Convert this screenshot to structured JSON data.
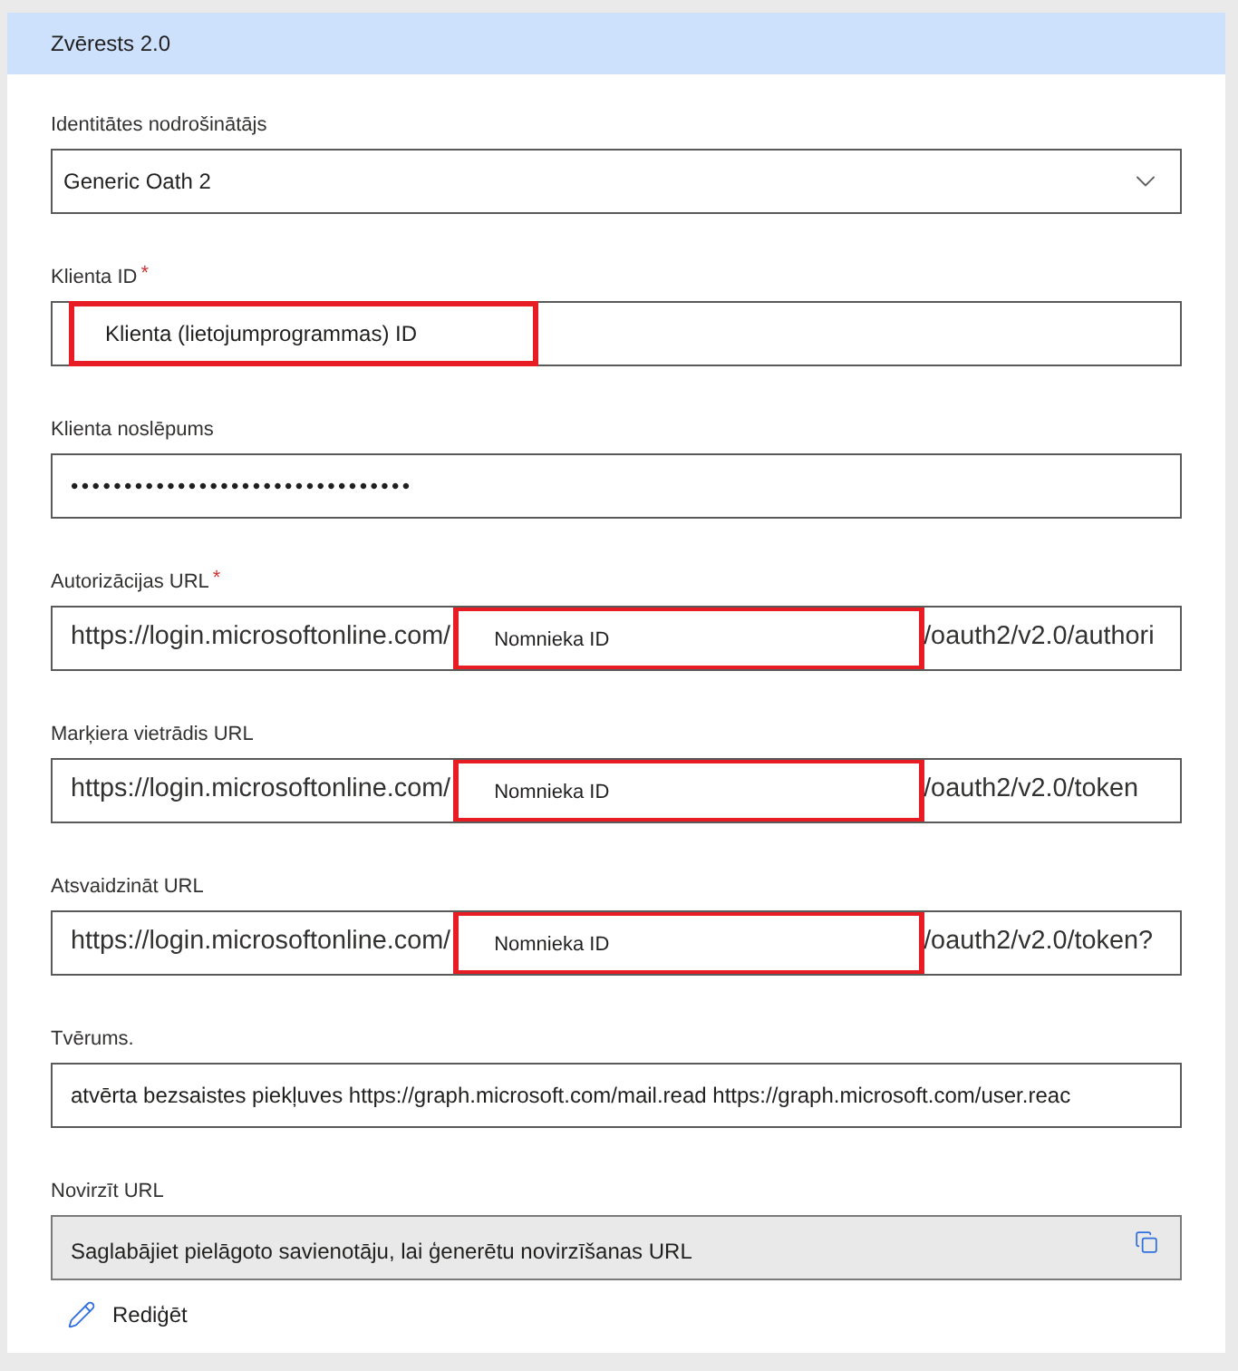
{
  "header": {
    "title": "Zvērests 2.0"
  },
  "fields": [
    {
      "kind": "dropdown",
      "label": "Identitātes nodrošinātājs",
      "value": "Generic Oath 2"
    },
    {
      "kind": "annotated",
      "label": "Klienta ID",
      "required_mark": "*",
      "annotation": "Klienta (lietojumprogrammas) ID"
    },
    {
      "kind": "password",
      "label": "Klienta noslēpums",
      "value": "••••••••••••••••••••••••••••••••"
    },
    {
      "kind": "url",
      "label": "Autorizācijas URL",
      "required_mark": "*",
      "prefix": "https://login.microsoftonline.com/",
      "annotation": "Nomnieka ID",
      "suffix": "/oauth2/v2.0/authori"
    },
    {
      "kind": "url",
      "label": "Marķiera vietrādis URL",
      "prefix": "https://login.microsoftonline.com/",
      "annotation": "Nomnieka ID",
      "suffix": "/oauth2/v2.0/token"
    },
    {
      "kind": "url",
      "label": "Atsvaidzināt URL",
      "prefix": "https://login.microsoftonline.com/",
      "annotation": "Nomnieka ID",
      "suffix": "/oauth2/v2.0/token?"
    },
    {
      "kind": "text",
      "label": "Tvērums.",
      "value": "atvērta bezsaistes piekļuves https://graph.microsoft.com/mail.read https://graph.microsoft.com/user.reac"
    },
    {
      "kind": "readonly",
      "label": "Novirzīt URL",
      "value": "Saglabājiet pielāgoto savienotāju, lai ģenerētu novirzīšanas URL"
    }
  ],
  "edit_link": {
    "label": "Rediģēt"
  }
}
